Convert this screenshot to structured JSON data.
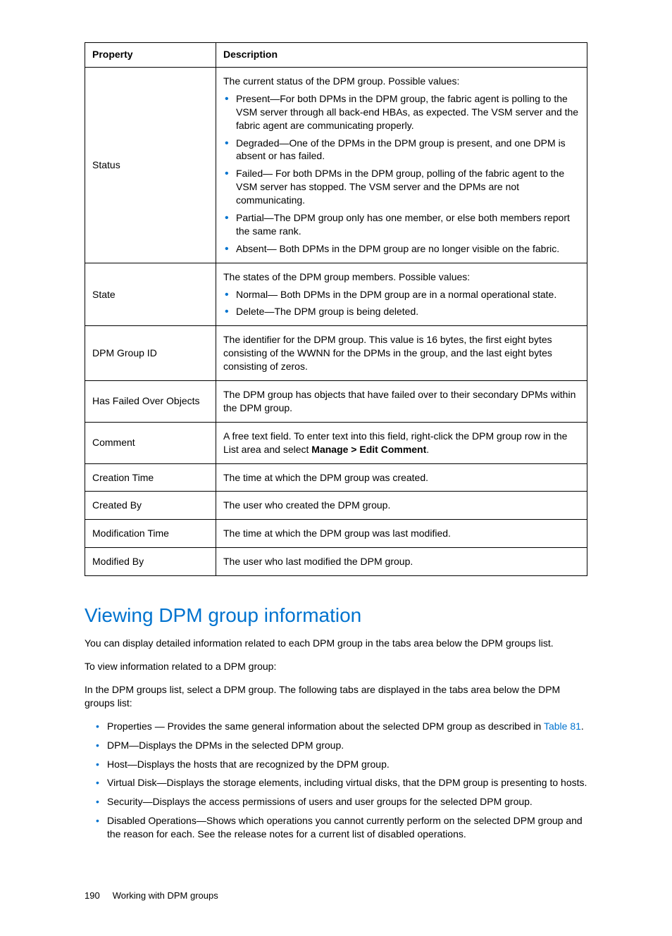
{
  "table": {
    "headers": {
      "property": "Property",
      "description": "Description"
    },
    "rows": {
      "status": {
        "name": "Status",
        "intro": "The current status of the DPM group. Possible values:",
        "items": [
          "Present—For both DPMs in the DPM group, the fabric agent is polling to the VSM server through all back-end HBAs, as expected. The VSM server and the fabric agent are communicating properly.",
          "Degraded—One of the DPMs in the DPM group is present, and one DPM is absent or has failed.",
          "Failed— For both DPMs in the DPM group, polling of the fabric agent to the VSM server has stopped. The VSM server and the DPMs are not communicating.",
          "Partial—The DPM group only has one member, or else both members report the same rank.",
          "Absent— Both DPMs in the DPM group are no longer visible on the fabric."
        ]
      },
      "state": {
        "name": "State",
        "intro": "The states of the DPM group members. Possible values:",
        "items": [
          "Normal— Both DPMs in the DPM group are in a normal operational state.",
          "Delete—The DPM group is being deleted."
        ]
      },
      "dpm_group_id": {
        "name": "DPM Group ID",
        "desc": "The identifier for the DPM group. This value is 16 bytes, the first eight bytes consisting of the WWNN for the DPMs in the group, and the last eight bytes consisting of zeros."
      },
      "has_failed_over": {
        "name": "Has Failed Over Objects",
        "desc": "The DPM group has objects that have failed over to their secondary DPMs within the DPM group."
      },
      "comment": {
        "name": "Comment",
        "desc_pre": "A free text field. To enter text into this field, right-click the DPM group row in the List area and select ",
        "desc_bold": "Manage > Edit Comment",
        "desc_post": "."
      },
      "creation_time": {
        "name": "Creation Time",
        "desc": "The time at which the DPM group was created."
      },
      "created_by": {
        "name": "Created By",
        "desc": "The user who created the DPM group."
      },
      "modification_time": {
        "name": "Modification Time",
        "desc": "The time at which the DPM group was last modified."
      },
      "modified_by": {
        "name": "Modified By",
        "desc": "The user who last modified the DPM group."
      }
    }
  },
  "section": {
    "heading": "Viewing DPM group information",
    "p1": "You can display detailed information related to each DPM group in the tabs area below the DPM groups list.",
    "p2": "To view information related to a DPM group:",
    "p3": "In the DPM groups list, select a DPM group. The following tabs are displayed in the tabs area below the DPM groups list:",
    "items": {
      "properties_pre": "Properties — Provides the same general information about the selected DPM group as described in ",
      "properties_link": "Table 81",
      "properties_post": ".",
      "dpm": "DPM—Displays the DPMs in the selected DPM group.",
      "host": "Host—Displays the hosts that are recognized by the DPM group.",
      "virtual_disk": "Virtual Disk—Displays the storage elements, including virtual disks, that the DPM group is presenting to hosts.",
      "security": "Security—Displays the access permissions of users and user groups for the selected DPM group.",
      "disabled_ops": "Disabled Operations—Shows which operations you cannot currently perform on the selected DPM group and the reason for each. See the release notes for a current list of disabled operations."
    }
  },
  "footer": {
    "page_number": "190",
    "chapter": "Working with DPM groups"
  }
}
